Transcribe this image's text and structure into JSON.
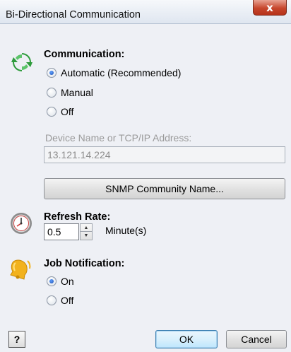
{
  "window": {
    "title": "Bi-Directional Communication",
    "close_label": "x"
  },
  "communication": {
    "title": "Communication:",
    "options": [
      {
        "label": "Automatic (Recommended)",
        "checked": true
      },
      {
        "label": "Manual",
        "checked": false
      },
      {
        "label": "Off",
        "checked": false
      }
    ],
    "device_label": "Device Name or TCP/IP Address:",
    "device_value": "13.121.14.224",
    "snmp_button": "SNMP Community Name..."
  },
  "refresh": {
    "title": "Refresh Rate:",
    "value": "0.5",
    "unit": "Minute(s)"
  },
  "notification": {
    "title": "Job Notification:",
    "options": [
      {
        "label": "On",
        "checked": true
      },
      {
        "label": "Off",
        "checked": false
      }
    ]
  },
  "footer": {
    "help_label": "?",
    "ok_label": "OK",
    "cancel_label": "Cancel"
  },
  "colors": {
    "accent_green": "#2e9b3c",
    "title_close": "#c7472d"
  },
  "icons": {
    "communication": "refresh-arrows-icon",
    "refresh": "clock-icon",
    "notification": "bell-icon"
  }
}
